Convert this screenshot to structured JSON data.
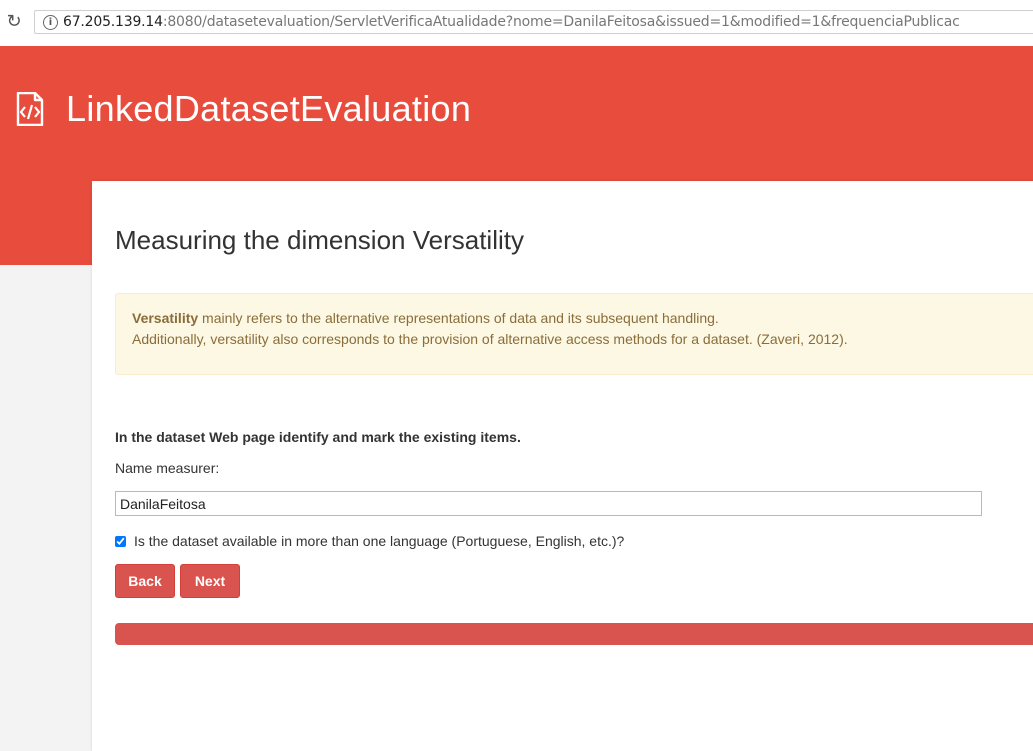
{
  "browser": {
    "url_host": "67.205.139.14",
    "url_rest": ":8080/datasetevaluation/ServletVerificaAtualidade?nome=DanilaFeitosa&issued=1&modified=1&frequenciaPublicac"
  },
  "header": {
    "title": "LinkedDatasetEvaluation"
  },
  "main": {
    "title": "Measuring the dimension Versatility",
    "alert": {
      "bold_term": "Versatility",
      "line1_rest": " mainly refers to the alternative representations of data and its subsequent handling.",
      "line2": "Additionally, versatility also corresponds to the provision of alternative access methods for a dataset. (Zaveri, 2012)."
    },
    "instruction": "In the dataset Web page identify and mark the existing items.",
    "name_label": "Name measurer:",
    "name_value": "DanilaFeitosa",
    "checkbox_label": "Is the dataset available in more than one language (Portuguese, English, etc.)?",
    "checkbox_checked": true,
    "back_label": "Back",
    "next_label": "Next",
    "progress": 1.0
  },
  "colors": {
    "header_red": "#e84c3d",
    "button_red": "#d9534f",
    "alert_bg": "#fcf8e3",
    "alert_text": "#8a6d3b"
  }
}
